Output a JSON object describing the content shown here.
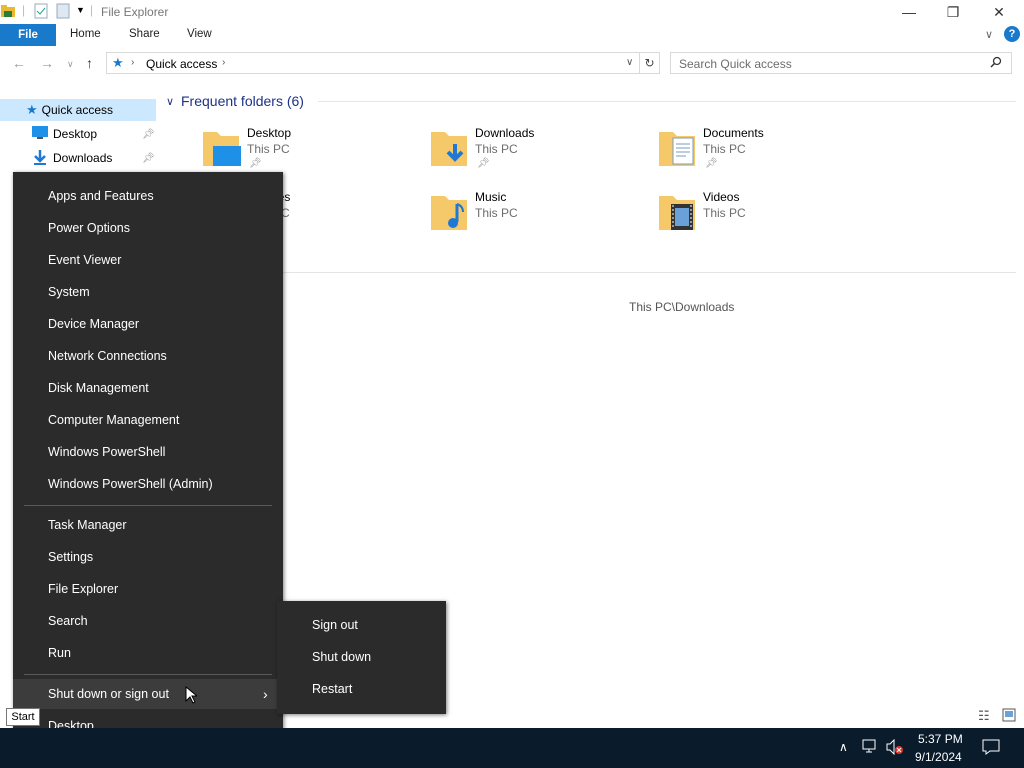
{
  "window": {
    "title": "File Explorer"
  },
  "ribbon": {
    "tabs": [
      "File",
      "Home",
      "Share",
      "View"
    ]
  },
  "address": {
    "path": "Quick access",
    "search_placeholder": "Search Quick access"
  },
  "navpane": {
    "items": [
      "Quick access",
      "Desktop",
      "Downloads"
    ]
  },
  "content": {
    "group_title": "Frequent folders (6)",
    "folders": [
      {
        "name": "Desktop",
        "location": "This PC"
      },
      {
        "name": "Downloads",
        "location": "This PC"
      },
      {
        "name": "Documents",
        "location": "This PC"
      },
      {
        "name": "Pictures",
        "location": "This PC"
      },
      {
        "name": "Music",
        "location": "This PC"
      },
      {
        "name": "Videos",
        "location": "This PC"
      }
    ],
    "recent_path": "This PC\\Downloads"
  },
  "winx_menu": {
    "items": [
      "Apps and Features",
      "Power Options",
      "Event Viewer",
      "System",
      "Device Manager",
      "Network Connections",
      "Disk Management",
      "Computer Management",
      "Windows PowerShell",
      "Windows PowerShell (Admin)",
      "Task Manager",
      "Settings",
      "File Explorer",
      "Search",
      "Run",
      "Shut down or sign out",
      "Desktop"
    ]
  },
  "submenu": {
    "items": [
      "Sign out",
      "Shut down",
      "Restart"
    ]
  },
  "taskbar": {
    "start_tooltip": "Start",
    "time": "5:37 PM",
    "date": "9/1/2024"
  },
  "colors": {
    "accent": "#1979ca",
    "menu_bg": "#2b2b2b",
    "taskbar_bg": "#0a1b2b"
  }
}
